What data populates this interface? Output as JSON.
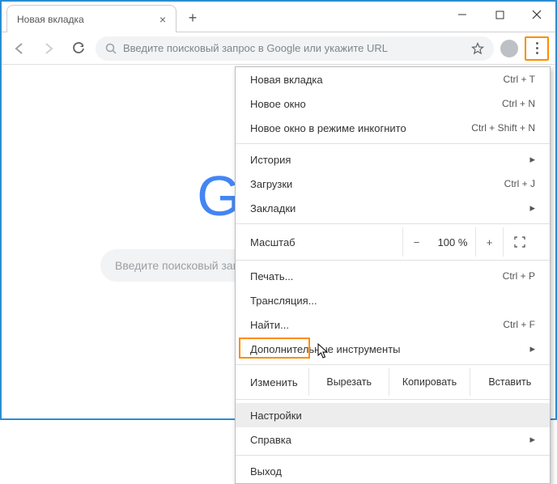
{
  "window": {
    "tab_title": "Новая вкладка"
  },
  "toolbar": {
    "omnibox_placeholder": "Введите поисковый запрос в Google или укажите URL"
  },
  "page": {
    "logo": "Google",
    "search_placeholder": "Введите поисковый запрос или URL"
  },
  "menu": {
    "new_tab": {
      "label": "Новая вкладка",
      "shortcut": "Ctrl + T"
    },
    "new_window": {
      "label": "Новое окно",
      "shortcut": "Ctrl + N"
    },
    "incognito": {
      "label": "Новое окно в режиме инкогнито",
      "shortcut": "Ctrl + Shift + N"
    },
    "history": {
      "label": "История"
    },
    "downloads": {
      "label": "Загрузки",
      "shortcut": "Ctrl + J"
    },
    "bookmarks": {
      "label": "Закладки"
    },
    "zoom": {
      "label": "Масштаб",
      "value": "100 %",
      "minus": "−",
      "plus": "+"
    },
    "print": {
      "label": "Печать...",
      "shortcut": "Ctrl + P"
    },
    "cast": {
      "label": "Трансляция..."
    },
    "find": {
      "label": "Найти...",
      "shortcut": "Ctrl + F"
    },
    "more_tools": {
      "label": "Дополнительные инструменты"
    },
    "edit": {
      "label": "Изменить",
      "cut": "Вырезать",
      "copy": "Копировать",
      "paste": "Вставить"
    },
    "settings": {
      "label": "Настройки"
    },
    "help": {
      "label": "Справка"
    },
    "exit": {
      "label": "Выход"
    }
  }
}
